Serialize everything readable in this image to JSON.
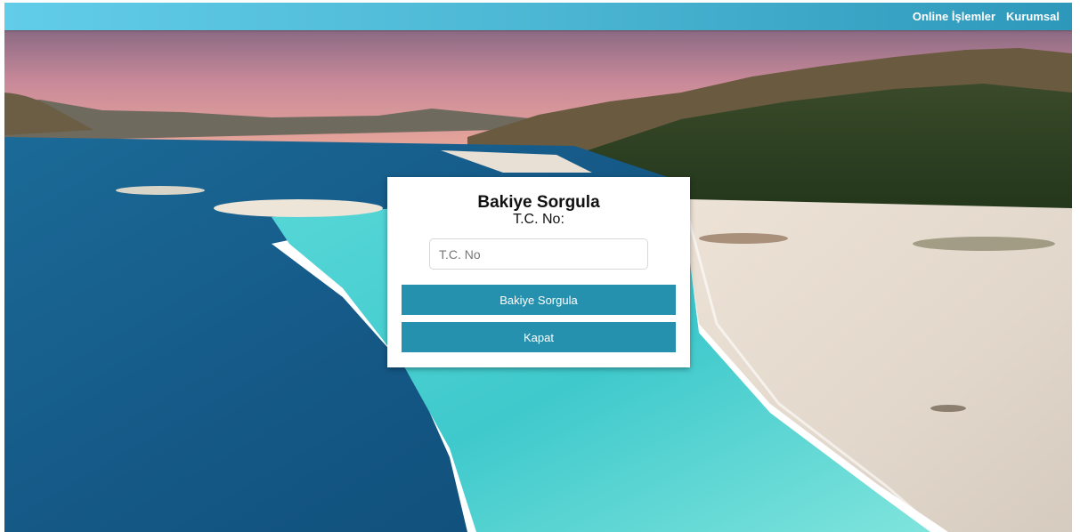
{
  "nav": {
    "items": [
      {
        "label": "Online İşlemler"
      },
      {
        "label": "Kurumsal"
      }
    ]
  },
  "background": {
    "description_icon": "landscape-lake-photo"
  },
  "modal": {
    "title": "Bakiye Sorgula",
    "field_label": "T.C. No:",
    "input_placeholder": "T.C. No",
    "input_value": "",
    "query_button_label": "Bakiye Sorgula",
    "close_button_label": "Kapat"
  },
  "colors": {
    "topbar_start": "#62cde8",
    "topbar_end": "#2e98bb",
    "button": "#2591af"
  }
}
